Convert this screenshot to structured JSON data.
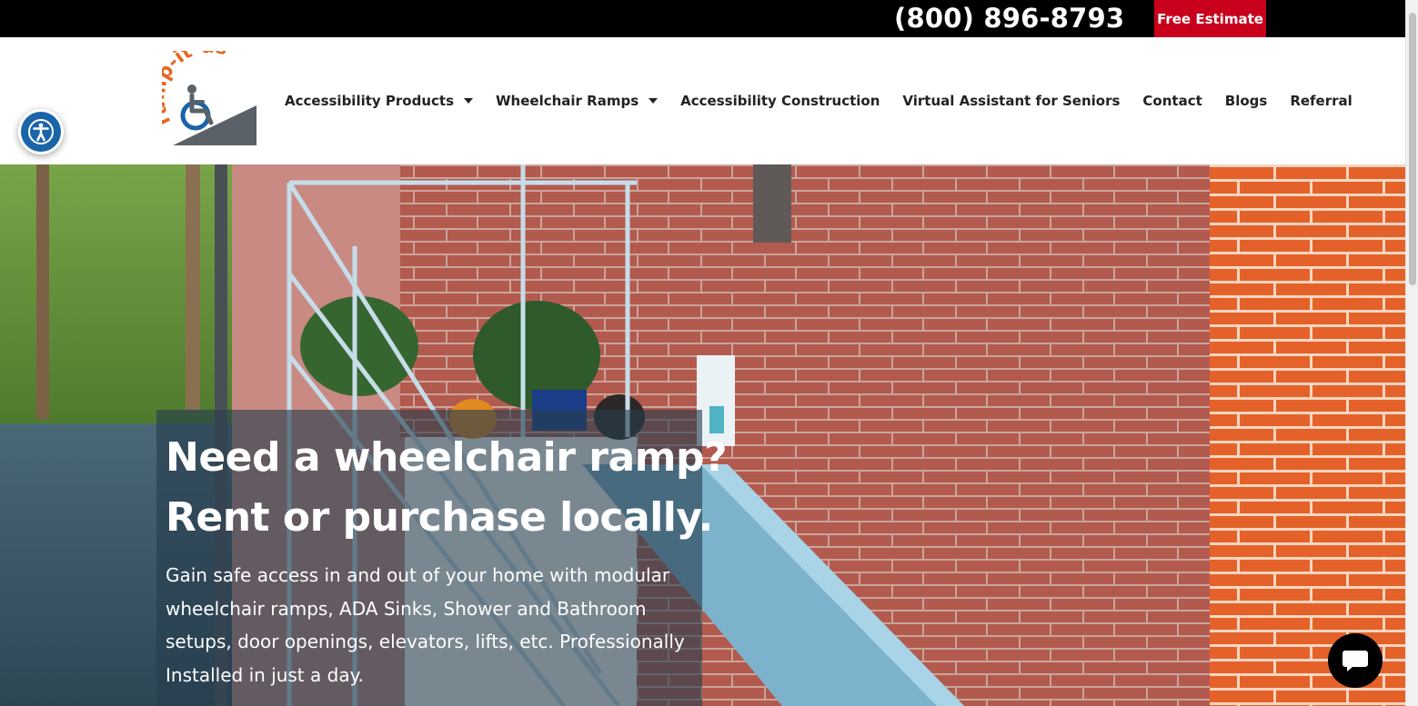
{
  "topbar": {
    "phone": "(800) 896-8793",
    "estimate_label": "Free Estimate"
  },
  "logo": {
    "text": "ramp-it-us"
  },
  "nav": {
    "items": [
      {
        "label": "Accessibility Products"
      },
      {
        "label": "Wheelchair Ramps"
      },
      {
        "label": "Accessibility Construction"
      },
      {
        "label": "Virtual Assistant for Seniors"
      },
      {
        "label": "Contact"
      },
      {
        "label": "Blogs"
      },
      {
        "label": "Referral"
      }
    ]
  },
  "hero": {
    "title_line1": "Need a wheelchair ramp?",
    "title_line2": "Rent or purchase locally.",
    "text_lines": [
      "Gain safe access in and out of your home with modular",
      "wheelchair ramps, ADA Sinks, Shower and Bathroom",
      "setups, door openings, elevators, lifts, etc. Professionally",
      "Installed in just a day."
    ]
  },
  "widgets": {
    "accessibility_icon": "accessibility-icon",
    "chat_icon": "chat-bubble-icon"
  },
  "colors": {
    "topbar": "#000000",
    "estimate": "#c8001b",
    "accessibility": "#1a64a8",
    "logo_orange": "#e8661f",
    "logo_gray": "#5b6168"
  }
}
